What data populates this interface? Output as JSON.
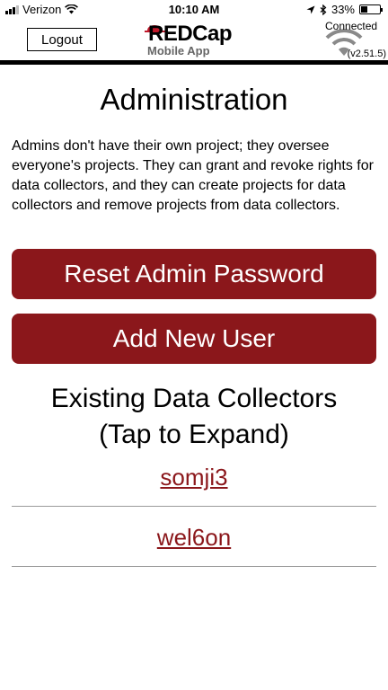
{
  "status_bar": {
    "carrier": "Verizon",
    "time": "10:10 AM",
    "battery_percent": "33%",
    "battery_level": 0.33,
    "icons": [
      "signal-icon",
      "wifi-icon",
      "location-arrow-icon",
      "bluetooth-icon",
      "battery-icon"
    ]
  },
  "header": {
    "logout_label": "Logout",
    "logo_title": "REDCap",
    "logo_subtitle": "Mobile App",
    "connection_status": "Connected",
    "version": "(v2.51.5)"
  },
  "main": {
    "title": "Administration",
    "description": "Admins don't have their own project; they oversee everyone's projects. They can grant and revoke rights for data collectors, and they can create projects for data collectors and remove projects from data collectors.",
    "reset_password_label": "Reset Admin Password",
    "add_user_label": "Add New User",
    "collectors_title_line1": "Existing Data Collectors",
    "collectors_title_line2": "(Tap to Expand)",
    "collectors": [
      "somji3",
      "wel6on"
    ]
  },
  "colors": {
    "accent": "#8b171b",
    "divider": "#9a9a9a",
    "header_rule": "#000000"
  }
}
